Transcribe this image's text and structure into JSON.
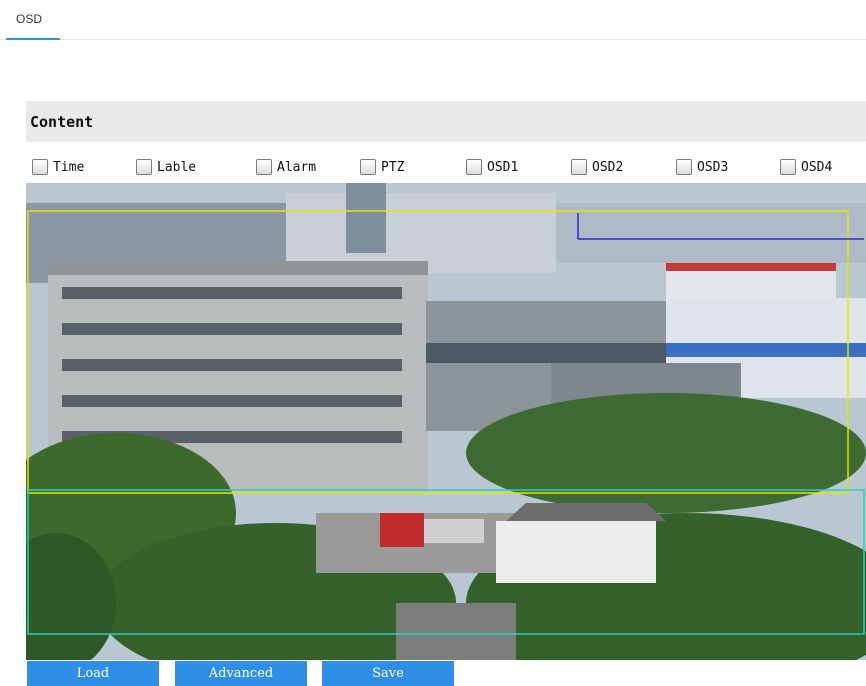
{
  "tabs": [
    {
      "label": "OSD",
      "active": true
    }
  ],
  "content": {
    "title": "Content",
    "checkboxes": [
      {
        "label": "Time",
        "checked": false
      },
      {
        "label": "Lable",
        "checked": false
      },
      {
        "label": "Alarm",
        "checked": false
      },
      {
        "label": "PTZ",
        "checked": false
      },
      {
        "label": "OSD1",
        "checked": false
      },
      {
        "label": "OSD2",
        "checked": false
      },
      {
        "label": "OSD3",
        "checked": false
      },
      {
        "label": "OSD4",
        "checked": false
      }
    ]
  },
  "buttons": {
    "load": "Load",
    "advanced": "Advanced",
    "save": "Save"
  },
  "colors": {
    "accent": "#2f8ee8",
    "overlay_yellow": "#e4e400",
    "overlay_cyan": "#2ad0b4",
    "overlay_blue": "#2a2ad0"
  }
}
